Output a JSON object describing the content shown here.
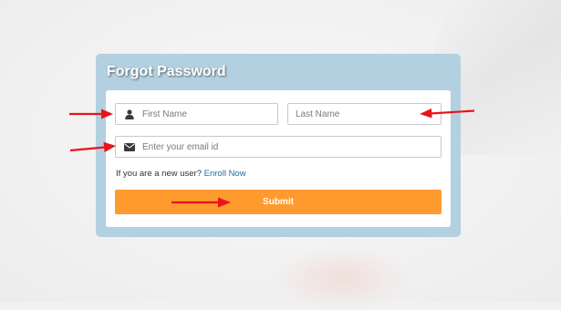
{
  "form": {
    "title": "Forgot Password",
    "first_name": {
      "placeholder": "First Name",
      "value": ""
    },
    "last_name": {
      "placeholder": "Last Name",
      "value": ""
    },
    "email": {
      "placeholder": "Enter your email id",
      "value": ""
    },
    "enroll_prompt": "If you are a new user?",
    "enroll_link": "Enroll Now",
    "submit_label": "Submit"
  },
  "icons": {
    "first_name": "user-icon",
    "email": "envelope-icon"
  },
  "annotations": {
    "arrow_color": "#e8141a"
  },
  "colors": {
    "header_panel": "#b3d0e0",
    "submit_button": "#ff9a2e",
    "link": "#1f6f9f"
  }
}
